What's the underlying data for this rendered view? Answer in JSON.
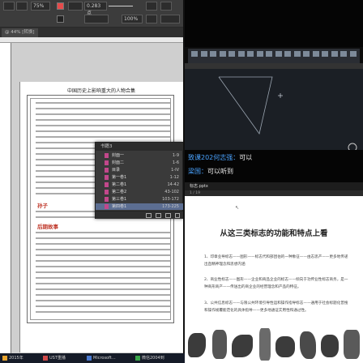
{
  "indesign": {
    "zoom": "75%",
    "stroke_weight": "0.283 点",
    "opacity": "100%",
    "doc_tab": "@ 44% [转换]",
    "book_title": "中国历史上影响重大的人物合集",
    "sections": [
      "孙子",
      "后期故事"
    ],
    "colors": {
      "accent": "#c2478b",
      "heading": "#c0392b",
      "selection": "#5c6e92"
    }
  },
  "pages_panel": {
    "title": "书籍3",
    "rows": [
      {
        "name": "封面一",
        "range": "1-9"
      },
      {
        "name": "封面二",
        "range": "1-6"
      },
      {
        "name": "目录",
        "range": "1-IV"
      },
      {
        "name": "第一卷1",
        "range": "1-12"
      },
      {
        "name": "第二卷1",
        "range": "14-42"
      },
      {
        "name": "第二卷2",
        "range": "43-102"
      },
      {
        "name": "第三卷1",
        "range": "103-172"
      },
      {
        "name": "第四卷1",
        "range": "173-225"
      }
    ],
    "selected_index": 7
  },
  "chat": {
    "messages": [
      {
        "user": "致课202何志强：",
        "text": "可以"
      },
      {
        "user": "梁国：",
        "text": "可以听到"
      }
    ]
  },
  "ppt": {
    "file_title": "标志.pptx",
    "slide_status": "1 / 19",
    "slide_title": "从这三类标志的功能和特点上看",
    "items": [
      "1、印章业导标志——图形——标志代和部团伯的一种象征——由志思产——更多地传递出直精神理念和思想内涵",
      "2、商业性标志——图形——企业和商品企业的标志——倾向于功传业性标志商务，是一种商形商产——传送出的商企业的经营理念和产品的特征。",
      "3、公共信息标志——与限公共环境引导性运和操作指导标志——通用于社会标题化普搜和操作规覆能范化的具体指导——更多地通证实用性和通过性。"
    ]
  },
  "taskbar": {
    "items": [
      "2015年",
      "UST重播",
      "Microsoft…",
      "微信2004到"
    ]
  }
}
